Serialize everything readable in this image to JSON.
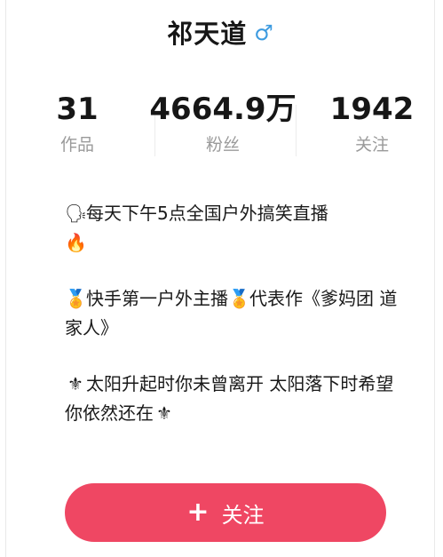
{
  "profile": {
    "name": "祁天道",
    "gender_symbol": "♂"
  },
  "stats": {
    "works": {
      "value": "31",
      "label": "作品"
    },
    "fans": {
      "value": "4664.9万",
      "label": "粉丝"
    },
    "following": {
      "value": "1942",
      "label": "关注"
    }
  },
  "bio": {
    "line1_emoji": "🗣",
    "line1_text": "每天下午5点全国户外搞笑直播",
    "line1_emoji_end": "🔥",
    "line2_emoji": "🏅",
    "line2_text": "快手第一户外主播",
    "line2_emoji_mid": "🏅",
    "line2_text2": "代表作《爹妈团 道家人》",
    "line3_emoji": "⚜",
    "line3_text": "太阳升起时你未曾离开 太阳落下时希望你依然还在",
    "line3_emoji_end": "⚜"
  },
  "actions": {
    "follow_plus": "+",
    "follow_label": "关注"
  },
  "colors": {
    "accent": "#ef4763",
    "gender": "#3d9be0",
    "muted": "#9a9a9a"
  }
}
